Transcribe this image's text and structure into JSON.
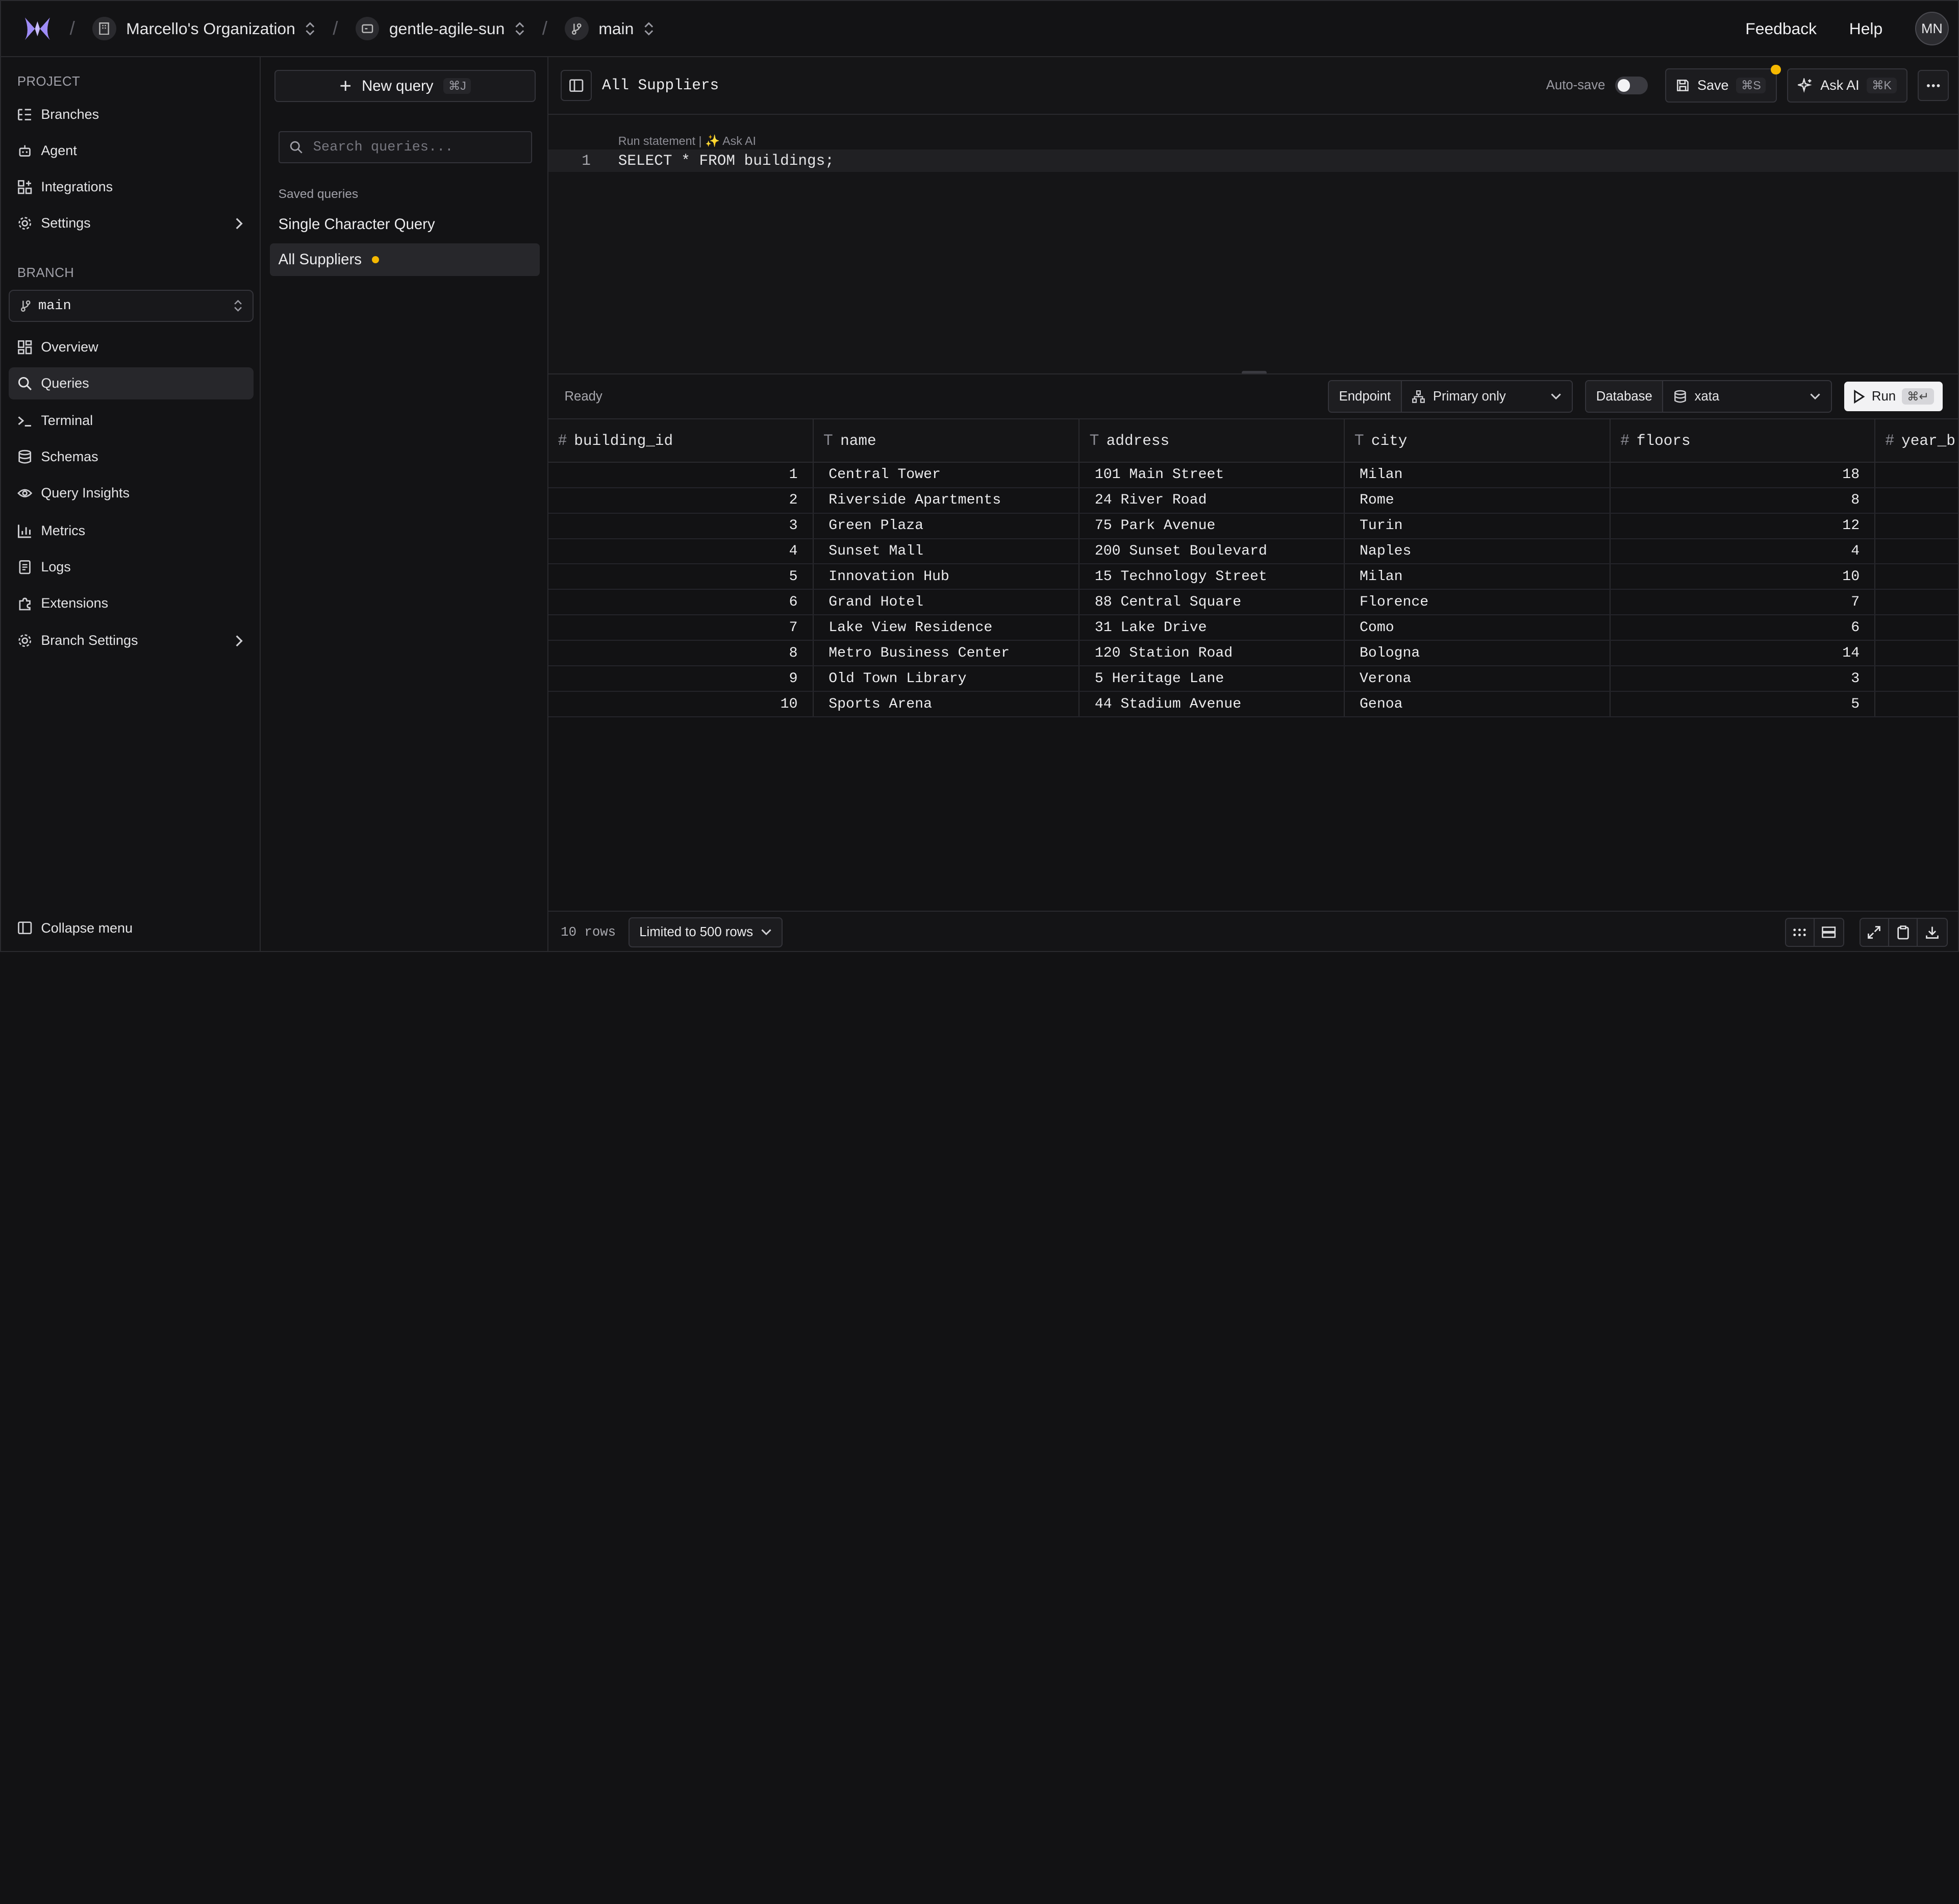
{
  "topbar": {
    "organization": "Marcello's Organization",
    "project": "gentle-agile-sun",
    "branch": "main",
    "feedback": "Feedback",
    "help": "Help",
    "avatar_initials": "MN"
  },
  "sidebar": {
    "project_label": "PROJECT",
    "project_items": [
      {
        "label": "Branches",
        "icon": "branches-icon"
      },
      {
        "label": "Agent",
        "icon": "robot-icon"
      },
      {
        "label": "Integrations",
        "icon": "puzzle-icon"
      },
      {
        "label": "Settings",
        "icon": "gear-icon"
      }
    ],
    "branch_label": "BRANCH",
    "branch_value": "main",
    "branch_items": [
      {
        "label": "Overview",
        "icon": "grid-icon"
      },
      {
        "label": "Queries",
        "icon": "search-icon",
        "active": true
      },
      {
        "label": "Terminal",
        "icon": "terminal-icon"
      },
      {
        "label": "Schemas",
        "icon": "database-icon"
      },
      {
        "label": "Query Insights",
        "icon": "eye-icon"
      },
      {
        "label": "Metrics",
        "icon": "bar-chart-icon"
      },
      {
        "label": "Logs",
        "icon": "logs-icon"
      },
      {
        "label": "Extensions",
        "icon": "puzzle-icon"
      },
      {
        "label": "Branch Settings",
        "icon": "gear-icon"
      }
    ],
    "collapse": "Collapse menu"
  },
  "queries_panel": {
    "new_query": "New query",
    "new_query_kbd": "⌘J",
    "search_placeholder": "Search queries...",
    "saved_label": "Saved queries",
    "saved": [
      {
        "label": "Single Character Query",
        "unsaved": false
      },
      {
        "label": "All Suppliers",
        "unsaved": true,
        "active": true
      }
    ]
  },
  "editor": {
    "title": "All Suppliers",
    "autosave": "Auto-save",
    "save": "Save",
    "save_kbd": "⌘S",
    "ask_ai": "Ask AI",
    "ask_ai_kbd": "⌘K",
    "codelens": "Run statement | ✨ Ask AI",
    "line_number": "1",
    "sql": "SELECT * FROM buildings;"
  },
  "results": {
    "status": "Ready",
    "endpoint_label": "Endpoint",
    "endpoint_value": "Primary only",
    "database_label": "Database",
    "database_value": "xata",
    "run": "Run",
    "run_kbd": "⌘↵",
    "columns": [
      {
        "type": "#",
        "name": "building_id"
      },
      {
        "type": "T",
        "name": "name"
      },
      {
        "type": "T",
        "name": "address"
      },
      {
        "type": "T",
        "name": "city"
      },
      {
        "type": "#",
        "name": "floors"
      },
      {
        "type": "#",
        "name": "year_b"
      }
    ],
    "rows": [
      [
        "1",
        "Central Tower",
        "101 Main Street",
        "Milan",
        "18"
      ],
      [
        "2",
        "Riverside Apartments",
        "24 River Road",
        "Rome",
        "8"
      ],
      [
        "3",
        "Green Plaza",
        "75 Park Avenue",
        "Turin",
        "12"
      ],
      [
        "4",
        "Sunset Mall",
        "200 Sunset Boulevard",
        "Naples",
        "4"
      ],
      [
        "5",
        "Innovation Hub",
        "15 Technology Street",
        "Milan",
        "10"
      ],
      [
        "6",
        "Grand Hotel",
        "88 Central Square",
        "Florence",
        "7"
      ],
      [
        "7",
        "Lake View Residence",
        "31 Lake Drive",
        "Como",
        "6"
      ],
      [
        "8",
        "Metro Business Center",
        "120 Station Road",
        "Bologna",
        "14"
      ],
      [
        "9",
        "Old Town Library",
        "5 Heritage Lane",
        "Verona",
        "3"
      ],
      [
        "10",
        "Sports Arena",
        "44 Stadium Avenue",
        "Genoa",
        "5"
      ]
    ],
    "row_count": "10 rows",
    "limit": "Limited to 500 rows"
  },
  "colors": {
    "accent_dot": "#f5b800",
    "background": "#121214"
  }
}
